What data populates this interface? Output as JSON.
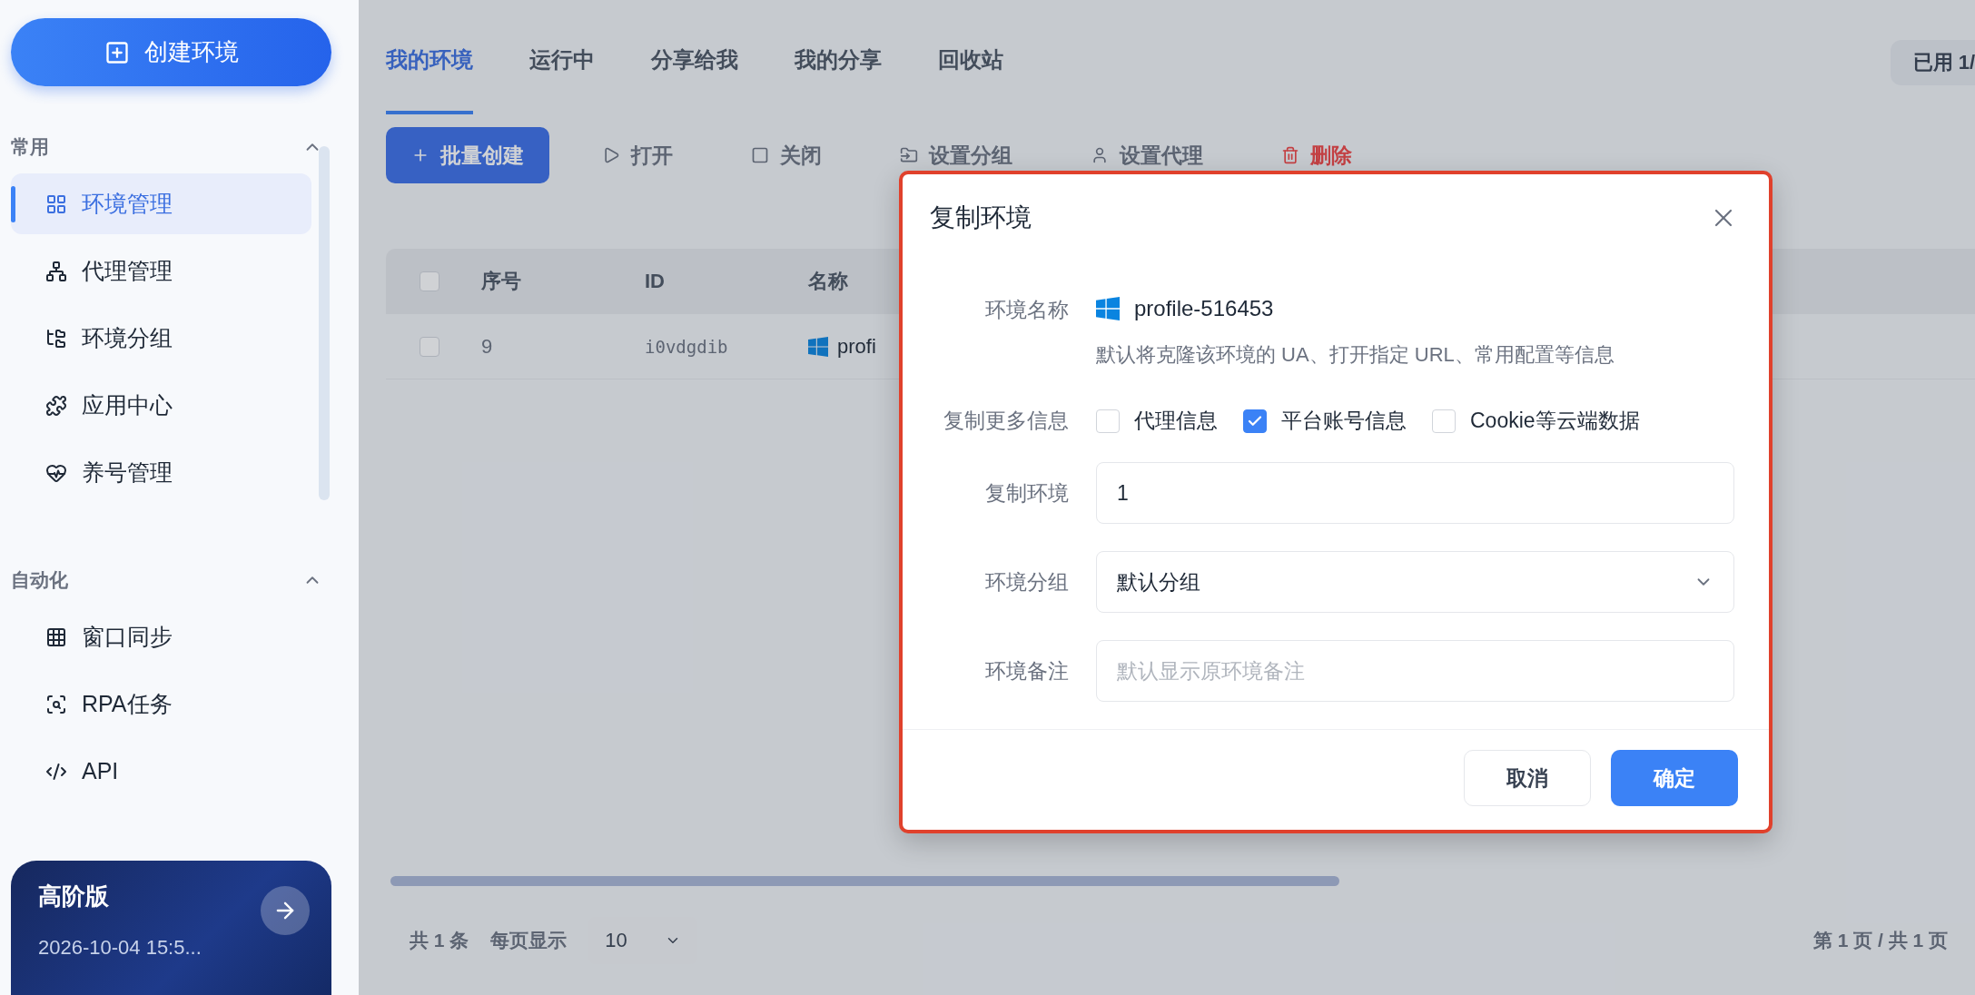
{
  "sidebar": {
    "create_button": "创建环境",
    "sections": [
      {
        "title": "常用",
        "expanded": true,
        "items": [
          {
            "label": "环境管理",
            "selected": true
          },
          {
            "label": "代理管理",
            "selected": false
          },
          {
            "label": "环境分组",
            "selected": false
          },
          {
            "label": "应用中心",
            "selected": false
          },
          {
            "label": "养号管理",
            "selected": false
          }
        ]
      },
      {
        "title": "自动化",
        "expanded": true,
        "items": [
          {
            "label": "窗口同步",
            "selected": false
          },
          {
            "label": "RPA任务",
            "selected": false
          },
          {
            "label": "API",
            "selected": false
          }
        ]
      }
    ],
    "plan_card": {
      "title": "高阶版",
      "expiry": "2026-10-04 15:5..."
    }
  },
  "main": {
    "tabs": [
      {
        "label": "我的环境",
        "selected": true
      },
      {
        "label": "运行中",
        "selected": false
      },
      {
        "label": "分享给我",
        "selected": false
      },
      {
        "label": "我的分享",
        "selected": false
      },
      {
        "label": "回收站",
        "selected": false
      }
    ],
    "usage": "已用 1/",
    "toolbar": [
      {
        "label": "批量创建",
        "kind": "primary"
      },
      {
        "label": "打开",
        "kind": "open"
      },
      {
        "label": "关闭",
        "kind": "close"
      },
      {
        "label": "设置分组",
        "kind": "group"
      },
      {
        "label": "设置代理",
        "kind": "proxy"
      },
      {
        "label": "删除",
        "kind": "danger"
      }
    ],
    "table": {
      "columns": [
        "序号",
        "ID",
        "名称"
      ],
      "all_checked": false,
      "rows": [
        {
          "checked": false,
          "cells": [
            "9",
            "i0vdgdib",
            "profi"
          ]
        }
      ]
    },
    "footer": {
      "total": "共 1 条",
      "page_size_label": "每页显示",
      "page_size": "10",
      "pages": "第 1 页 / 共 1 页"
    }
  },
  "dialog": {
    "title": "复制环境",
    "fields": [
      {
        "kind": "profile",
        "label": "环境名称",
        "value": "profile-516453",
        "hint": "默认将克隆该环境的 UA、打开指定 URL、常用配置等信息"
      },
      {
        "kind": "checkboxes",
        "label": "复制更多信息",
        "options": [
          {
            "label": "代理信息",
            "checked": false
          },
          {
            "label": "平台账号信息",
            "checked": true
          },
          {
            "label": "Cookie等云端数据",
            "checked": false
          }
        ]
      },
      {
        "kind": "input",
        "label": "复制环境",
        "value": "1"
      },
      {
        "kind": "select",
        "label": "环境分组",
        "value": "默认分组"
      },
      {
        "kind": "input",
        "label": "环境备注",
        "placeholder": "默认显示原环境备注"
      }
    ],
    "buttons": [
      {
        "label": "取消",
        "kind": "cancel"
      },
      {
        "label": "确定",
        "kind": "confirm"
      }
    ]
  }
}
